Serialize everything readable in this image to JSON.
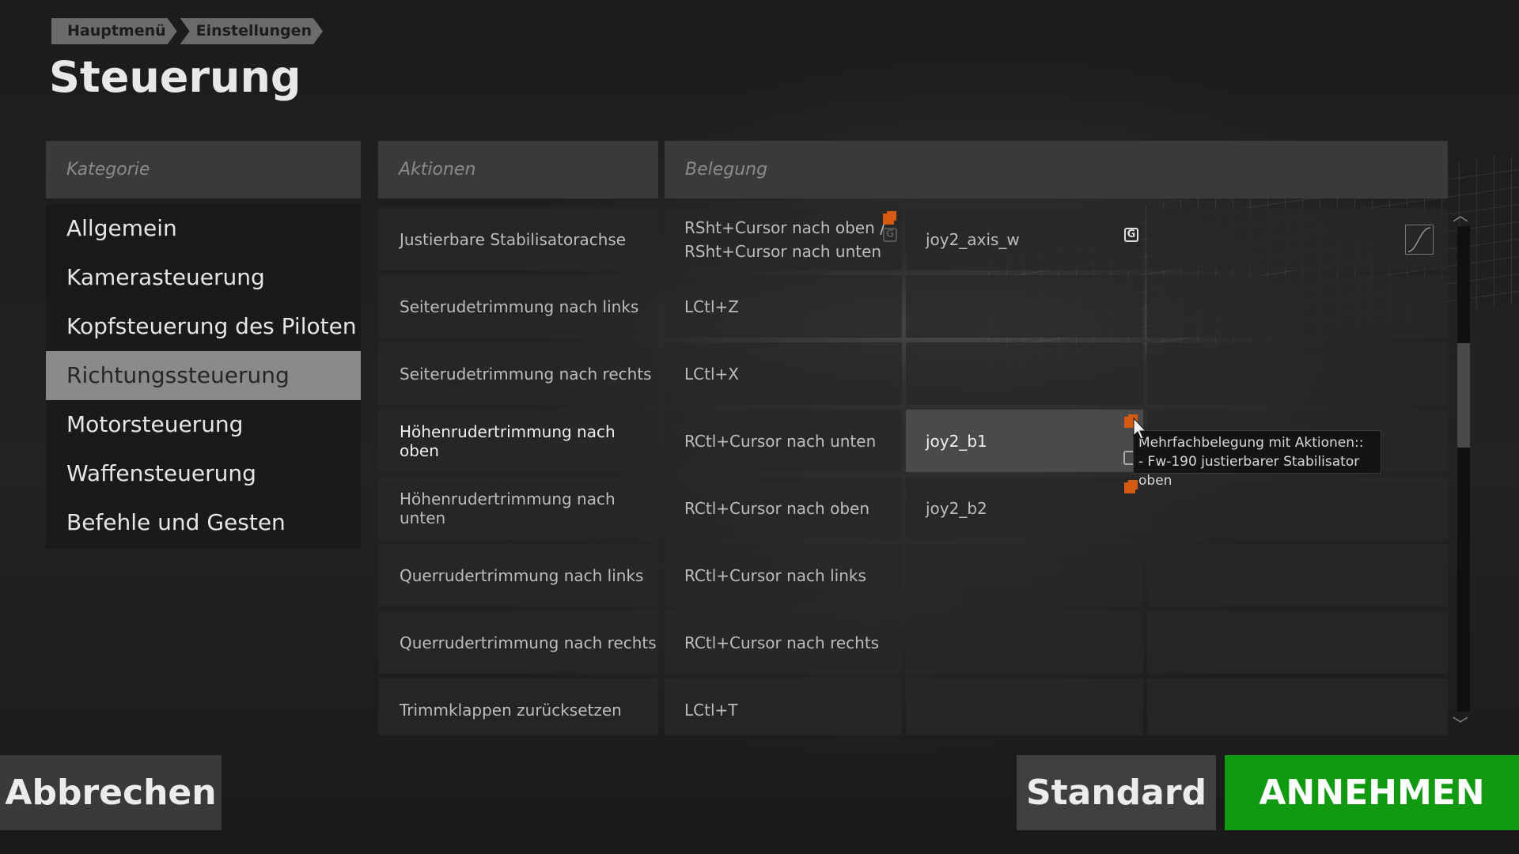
{
  "breadcrumb": [
    "Hauptmenü",
    "Einstellungen"
  ],
  "page_title": "Steuerung",
  "category": {
    "header": "Kategorie",
    "items": [
      {
        "label": "Allgemein",
        "selected": false
      },
      {
        "label": "Kamerasteuerung",
        "selected": false
      },
      {
        "label": "Kopfsteuerung des Piloten",
        "selected": false
      },
      {
        "label": "Richtungssteuerung",
        "selected": true
      },
      {
        "label": "Motorsteuerung",
        "selected": false
      },
      {
        "label": "Waffensteuerung",
        "selected": false
      },
      {
        "label": "Befehle und Gesten",
        "selected": false
      }
    ]
  },
  "table": {
    "header_actions": "Aktionen",
    "header_binding": "Belegung",
    "rows": [
      {
        "action": "Justierbare Stabilisatorachse",
        "binding1_line1": "RSht+Cursor nach oben /",
        "binding1_line2": "RSht+Cursor nach unten",
        "binding2": "joy2_axis_w",
        "binding3": ""
      },
      {
        "action": "Seiterudetrimmung nach links",
        "binding1_line1": "LCtl+Z",
        "binding1_line2": "",
        "binding2": "",
        "binding3": ""
      },
      {
        "action": "Seiterudetrimmung nach rechts",
        "binding1_line1": "LCtl+X",
        "binding1_line2": "",
        "binding2": "",
        "binding3": ""
      },
      {
        "action": "Höhenrudertrimmung nach oben",
        "binding1_line1": "RCtl+Cursor nach unten",
        "binding1_line2": "",
        "binding2": "joy2_b1",
        "binding3": ""
      },
      {
        "action": "Höhenrudertrimmung nach unten",
        "binding1_line1": "RCtl+Cursor nach oben",
        "binding1_line2": "",
        "binding2": "joy2_b2",
        "binding3": ""
      },
      {
        "action": "Querrudertrimmung nach links",
        "binding1_line1": "RCtl+Cursor nach links",
        "binding1_line2": "",
        "binding2": "",
        "binding3": ""
      },
      {
        "action": "Querrudertrimmung nach rechts",
        "binding1_line1": "RCtl+Cursor nach rechts",
        "binding1_line2": "",
        "binding2": "",
        "binding3": ""
      },
      {
        "action": "Trimmklappen zurücksetzen",
        "binding1_line1": "LCtl+T",
        "binding1_line2": "",
        "binding2": "",
        "binding3": ""
      }
    ]
  },
  "tooltip": {
    "line1": "Mehrfachbelegung mit Aktionen::",
    "line2": "- Fw-190 justierbarer Stabilisator oben"
  },
  "icons": {
    "conflict_color": "#d35a10",
    "swap_glyph": "G",
    "scroll_up": "︿",
    "scroll_down": "﹀"
  },
  "buttons": {
    "cancel": "Abbrechen",
    "default": "Standard",
    "accept": "ANNEHMEN"
  },
  "colors": {
    "accept_green": "#119a11",
    "selected_category": "#8a8a8a"
  }
}
